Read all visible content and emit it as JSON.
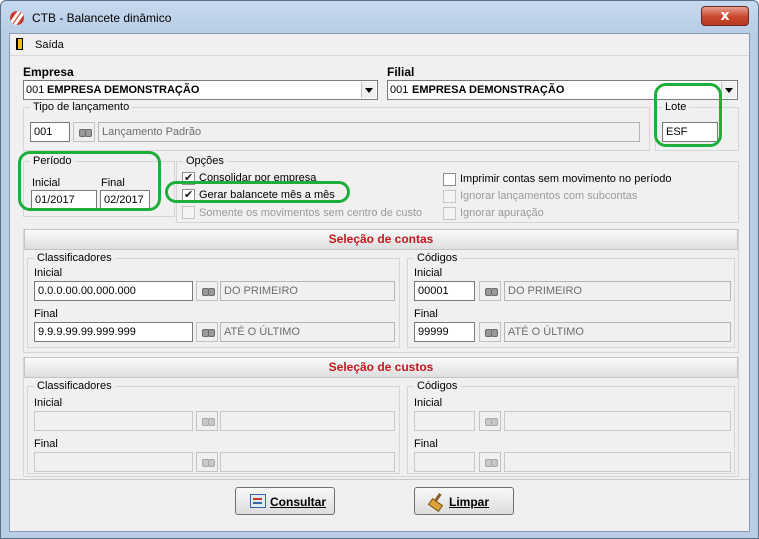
{
  "window": {
    "title": "CTB - Balancete dinâmico",
    "close_glyph": "x"
  },
  "menu": {
    "items": [
      {
        "label": "Saída",
        "icon": "exit-door-icon"
      }
    ]
  },
  "empresa": {
    "label": "Empresa",
    "code": "001",
    "name": "EMPRESA DEMONSTRAÇÃO"
  },
  "filial": {
    "label": "Filial",
    "code": "001",
    "name": "EMPRESA DEMONSTRAÇÃO"
  },
  "tipo_lancamento": {
    "label": "Tipo de lançamento",
    "code": "001",
    "description": "Lançamento Padrão"
  },
  "lote": {
    "label": "Lote",
    "value": "ESF"
  },
  "periodo": {
    "label": "Período",
    "inicial_label": "Inicial",
    "inicial_value": "01/2017",
    "final_label": "Final",
    "final_value": "02/2017"
  },
  "opcoes": {
    "label": "Opções",
    "options": [
      {
        "label": "Consolidar por empresa",
        "checked": true,
        "enabled": true
      },
      {
        "label": "Gerar balancete mês a mês",
        "checked": true,
        "enabled": true
      },
      {
        "label": "Somente os movimentos sem centro de custo",
        "checked": false,
        "enabled": false
      },
      {
        "label": "Imprimir contas sem movimento no período",
        "checked": false,
        "enabled": true
      },
      {
        "label": "Ignorar lançamentos com subcontas",
        "checked": false,
        "enabled": false
      },
      {
        "label": "Ignorar apuração",
        "checked": false,
        "enabled": false
      }
    ]
  },
  "selecao_contas": {
    "header": "Seleção de contas",
    "classificadores": {
      "label": "Classificadores",
      "inicial_label": "Inicial",
      "inicial_value": "0.0.0.00.00.000.000",
      "inicial_desc": "DO PRIMEIRO",
      "final_label": "Final",
      "final_value": "9.9.9.99.99.999.999",
      "final_desc": "ATÉ O ÚLTIMO"
    },
    "codigos": {
      "label": "Códigos",
      "inicial_label": "Inicial",
      "inicial_value": "00001",
      "inicial_desc": "DO PRIMEIRO",
      "final_label": "Final",
      "final_value": "99999",
      "final_desc": "ATÉ O ÚLTIMO"
    }
  },
  "selecao_custos": {
    "header": "Seleção de custos",
    "classificadores": {
      "label": "Classificadores",
      "inicial_label": "Inicial",
      "final_label": "Final"
    },
    "codigos": {
      "label": "Códigos",
      "inicial_label": "Inicial",
      "final_label": "Final"
    }
  },
  "buttons": {
    "consultar": {
      "label": "Consultar",
      "icon": "report-icon"
    },
    "limpar": {
      "label": "Limpar",
      "icon": "broom-icon"
    }
  },
  "highlight_color": "#1fae3c",
  "section_header_color": "#c0181e"
}
